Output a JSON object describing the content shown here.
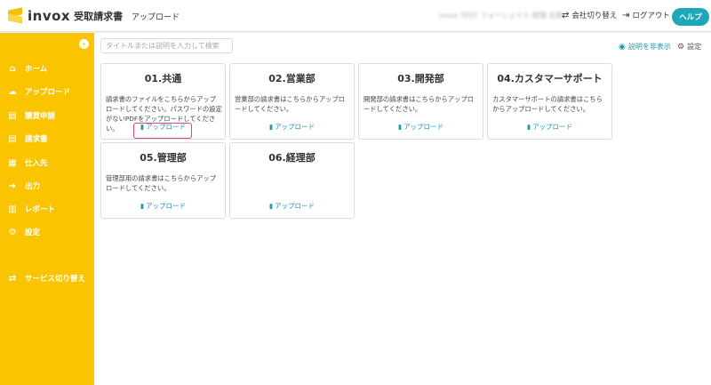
{
  "header": {
    "brand": "invox",
    "brand_sub": "受取請求書",
    "page_label": "アップロード",
    "user_name": "invox TEST フォーシェイル 経理 太郎",
    "switch_company": "会社切り替え",
    "logout": "ログアウト",
    "help": "ヘルプ"
  },
  "sidebar": {
    "collapse_icon": "chevron-left",
    "items": [
      {
        "label": "ホーム",
        "icon": "home-icon"
      },
      {
        "label": "アップロード",
        "icon": "cloud-upload-icon"
      },
      {
        "label": "購買申請",
        "icon": "document-icon"
      },
      {
        "label": "請求書",
        "icon": "invoice-icon"
      },
      {
        "label": "仕入先",
        "icon": "building-icon"
      },
      {
        "label": "出力",
        "icon": "export-icon"
      },
      {
        "label": "レポート",
        "icon": "chart-icon"
      },
      {
        "label": "設定",
        "icon": "gear-icon"
      }
    ],
    "service_switch": "サービス切り替え"
  },
  "main": {
    "search_placeholder": "タイトルまたは説明を入力して検索",
    "hide_description": "説明を非表示",
    "settings": "設定",
    "upload_label": "アップロード",
    "cards": [
      {
        "title": "01.共通",
        "desc": "請求書のファイルをこちらからアップロードしてください。パスワードの設定がないPDFをアップロードしてください。"
      },
      {
        "title": "02.営業部",
        "desc": "営業部の請求書はこちらからアップロードしてください。"
      },
      {
        "title": "03.開発部",
        "desc": "開発部の請求書はこちらからアップロードしてください。"
      },
      {
        "title": "04.カスタマーサポート",
        "desc": "カスタマーサポートの請求書はこちらからアップロードしてください。"
      },
      {
        "title": "05.管理部",
        "desc": "管理部用の請求書はこちらからアップロードしてください。"
      },
      {
        "title": "06.経理部",
        "desc": ""
      }
    ]
  },
  "colors": {
    "sidebar": "#fbc400",
    "accent": "#1a98b5",
    "help_button": "#1fa7b7",
    "highlight": "#e0457b"
  }
}
